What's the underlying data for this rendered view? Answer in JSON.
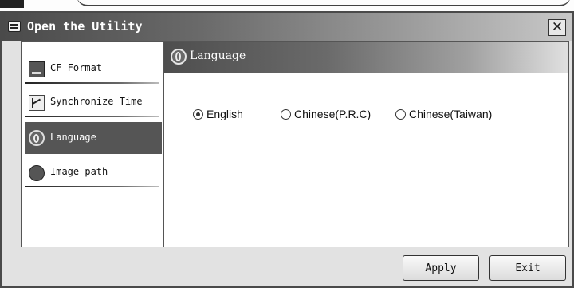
{
  "window": {
    "title": "Open the Utility",
    "close_icon": "close-icon"
  },
  "sidebar": {
    "items": [
      {
        "label": "CF Format",
        "icon": "cf-card-icon",
        "active": false
      },
      {
        "label": "Synchronize Time",
        "icon": "clock-icon",
        "active": false
      },
      {
        "label": "Language",
        "icon": "language-icon",
        "active": true
      },
      {
        "label": "Image path",
        "icon": "image-path-icon",
        "active": false
      }
    ]
  },
  "content": {
    "header": "Language",
    "options": [
      {
        "label": "English",
        "checked": true
      },
      {
        "label": "Chinese(P.R.C)",
        "checked": false
      },
      {
        "label": "Chinese(Taiwan)",
        "checked": false
      }
    ]
  },
  "buttons": {
    "apply": "Apply",
    "exit": "Exit"
  }
}
